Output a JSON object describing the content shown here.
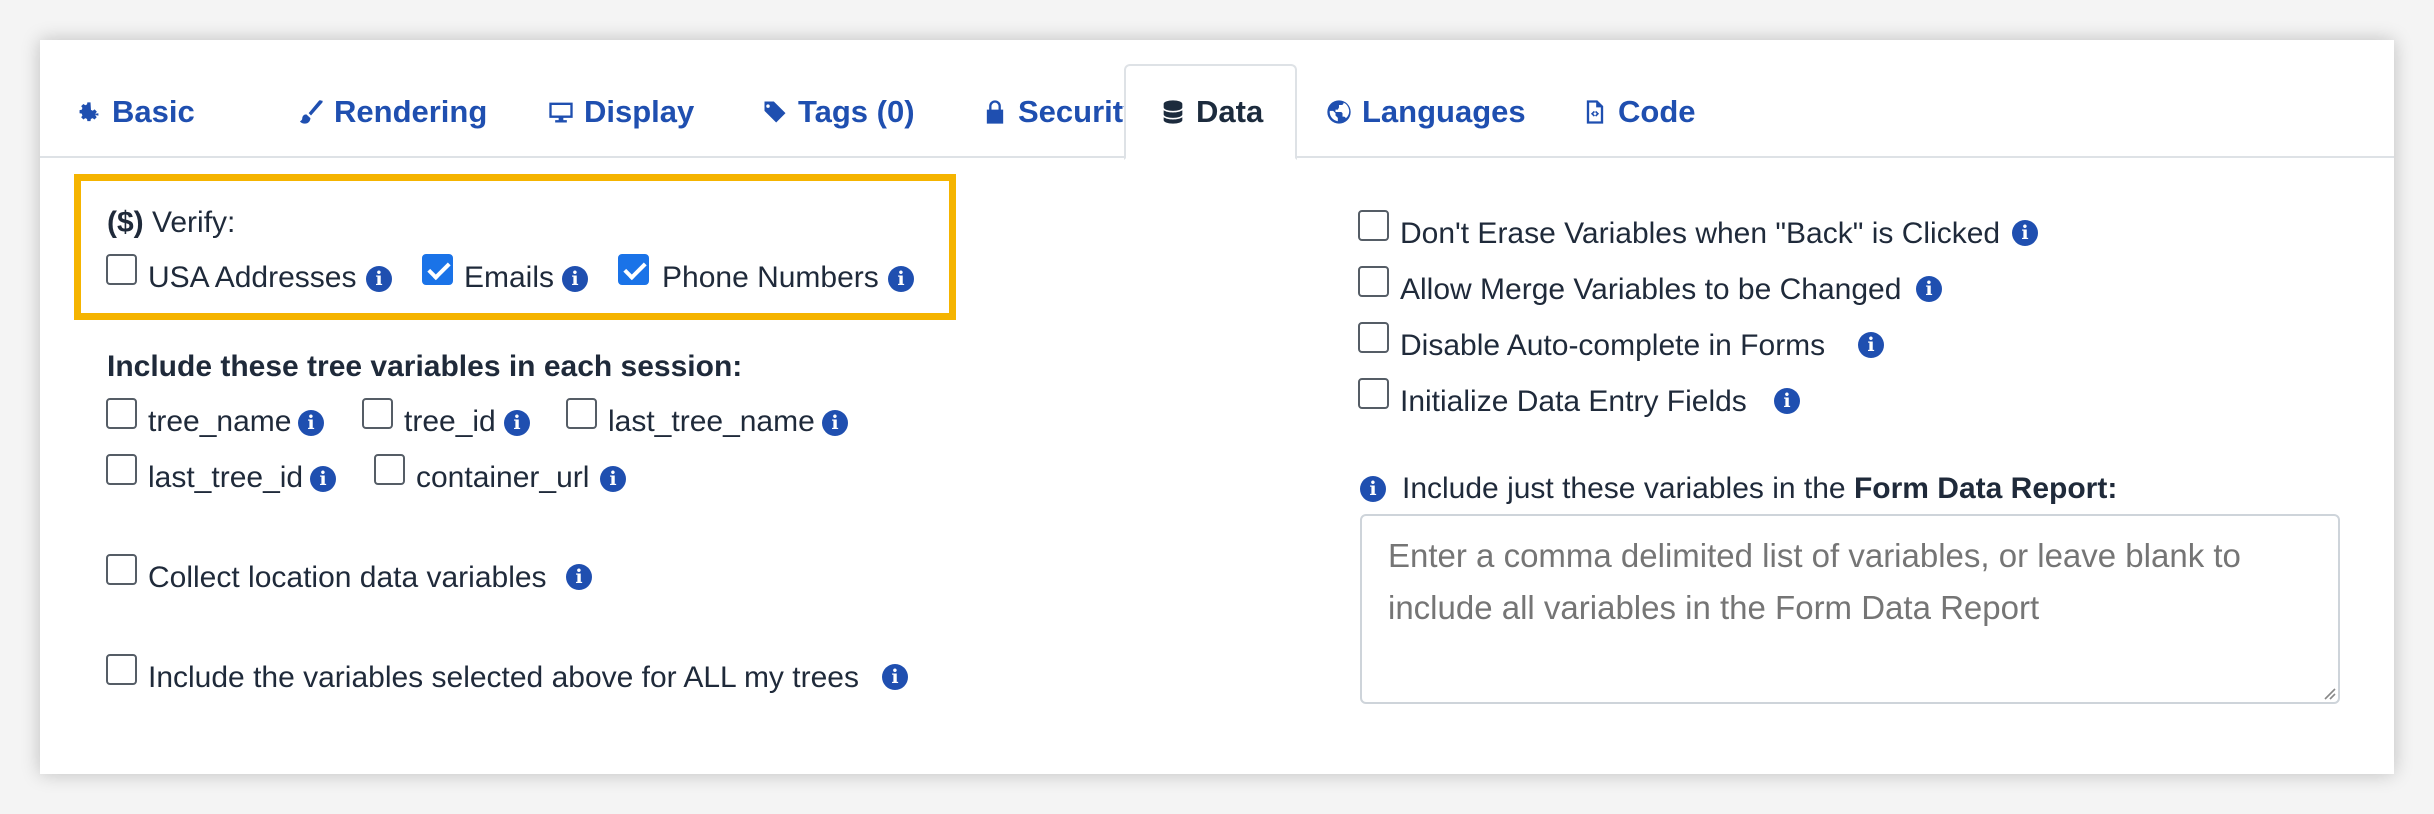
{
  "tabs": [
    {
      "label": "Basic",
      "icon": "gear-icon"
    },
    {
      "label": "Rendering",
      "icon": "paintbrush-icon"
    },
    {
      "label": "Display",
      "icon": "monitor-icon"
    },
    {
      "label": "Tags (0)",
      "icon": "tags-icon"
    },
    {
      "label": "Security",
      "icon": "lock-icon"
    },
    {
      "label": "Data",
      "icon": "database-icon",
      "active": true
    },
    {
      "label": "Languages",
      "icon": "globe-icon"
    },
    {
      "label": "Code",
      "icon": "code-file-icon"
    }
  ],
  "verify": {
    "prefix": "($)",
    "label": "Verify:",
    "options": [
      {
        "label": "USA Addresses",
        "checked": false
      },
      {
        "label": "Emails",
        "checked": true
      },
      {
        "label": "Phone Numbers",
        "checked": true
      }
    ]
  },
  "tree_vars": {
    "heading": "Include these tree variables in each session:",
    "options": [
      {
        "label": "tree_name",
        "checked": false
      },
      {
        "label": "tree_id",
        "checked": false
      },
      {
        "label": "last_tree_name",
        "checked": false
      },
      {
        "label": "last_tree_id",
        "checked": false
      },
      {
        "label": "container_url",
        "checked": false
      }
    ]
  },
  "location": {
    "label": "Collect location data variables",
    "checked": false
  },
  "all_trees": {
    "label": "Include the variables selected above for ALL my trees",
    "checked": false
  },
  "right_options": [
    {
      "label": "Don't Erase Variables when \"Back\" is Clicked",
      "checked": false
    },
    {
      "label": "Allow Merge Variables to be Changed",
      "checked": false
    },
    {
      "label": "Disable Auto-complete in Forms",
      "checked": false
    },
    {
      "label": "Initialize Data Entry Fields",
      "checked": false
    }
  ],
  "form_report": {
    "label_prefix": "Include just these variables in the",
    "label_bold": "Form Data Report:",
    "placeholder": "Enter a comma delimited list of variables, or leave blank to include all variables in the Form Data Report",
    "value": ""
  },
  "colors": {
    "accent": "#1f4fb0",
    "highlight_border": "#f5b400",
    "checkbox_checked": "#1a73e8"
  }
}
